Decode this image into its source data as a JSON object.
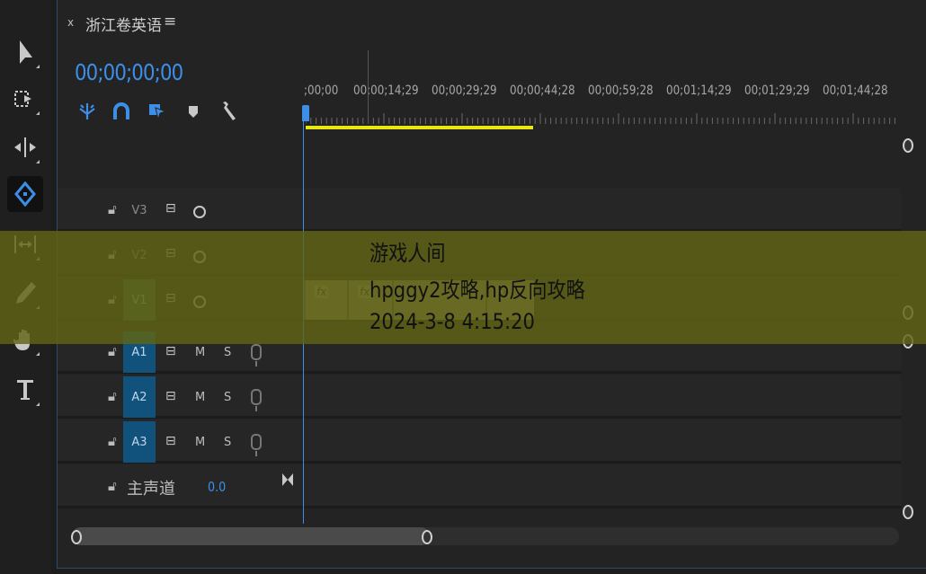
{
  "panel": {
    "close_label": "x",
    "title": "浙江卷英语",
    "menu_icon": "hamburger-menu-icon"
  },
  "timecode": "00;00;00;00",
  "header_icons": [
    "insert-nested-icon",
    "snap-magnet-icon",
    "linked-selection-icon",
    "marker-icon",
    "wrench-settings-icon"
  ],
  "tools": [
    "selection-arrow-icon",
    "track-select-forward-icon",
    "ripple-edit-icon",
    "razor-icon",
    "slip-icon",
    "pen-icon",
    "hand-icon",
    "type-icon"
  ],
  "ruler": {
    "labels": [
      ";00;00",
      "00;00;14;29",
      "00;00;29;29",
      "00;00;44;28",
      "00;00;59;28",
      "00;01;14;29",
      "00;01;29;29",
      "00;01;44;28"
    ]
  },
  "tracks": {
    "video": [
      {
        "name": "V3"
      },
      {
        "name": "V2"
      },
      {
        "name": "V1"
      }
    ],
    "audio": [
      {
        "name": "A1",
        "mute": "M",
        "solo": "S"
      },
      {
        "name": "A2",
        "mute": "M",
        "solo": "S"
      },
      {
        "name": "A3",
        "mute": "M",
        "solo": "S"
      }
    ],
    "master": {
      "name": "主声道",
      "value": "0.0"
    }
  },
  "clips": {
    "fx_label": "fx"
  },
  "overlay": {
    "line1": "游戏人间",
    "line2": "hpggy2攻略,hp反向攻略",
    "line3": "2024-3-8 4:15:20"
  },
  "colors": {
    "accent": "#3d8ee6",
    "work_area": "#e8e810",
    "video_track_active": "#345c45",
    "audio_track_active": "#11527d"
  }
}
